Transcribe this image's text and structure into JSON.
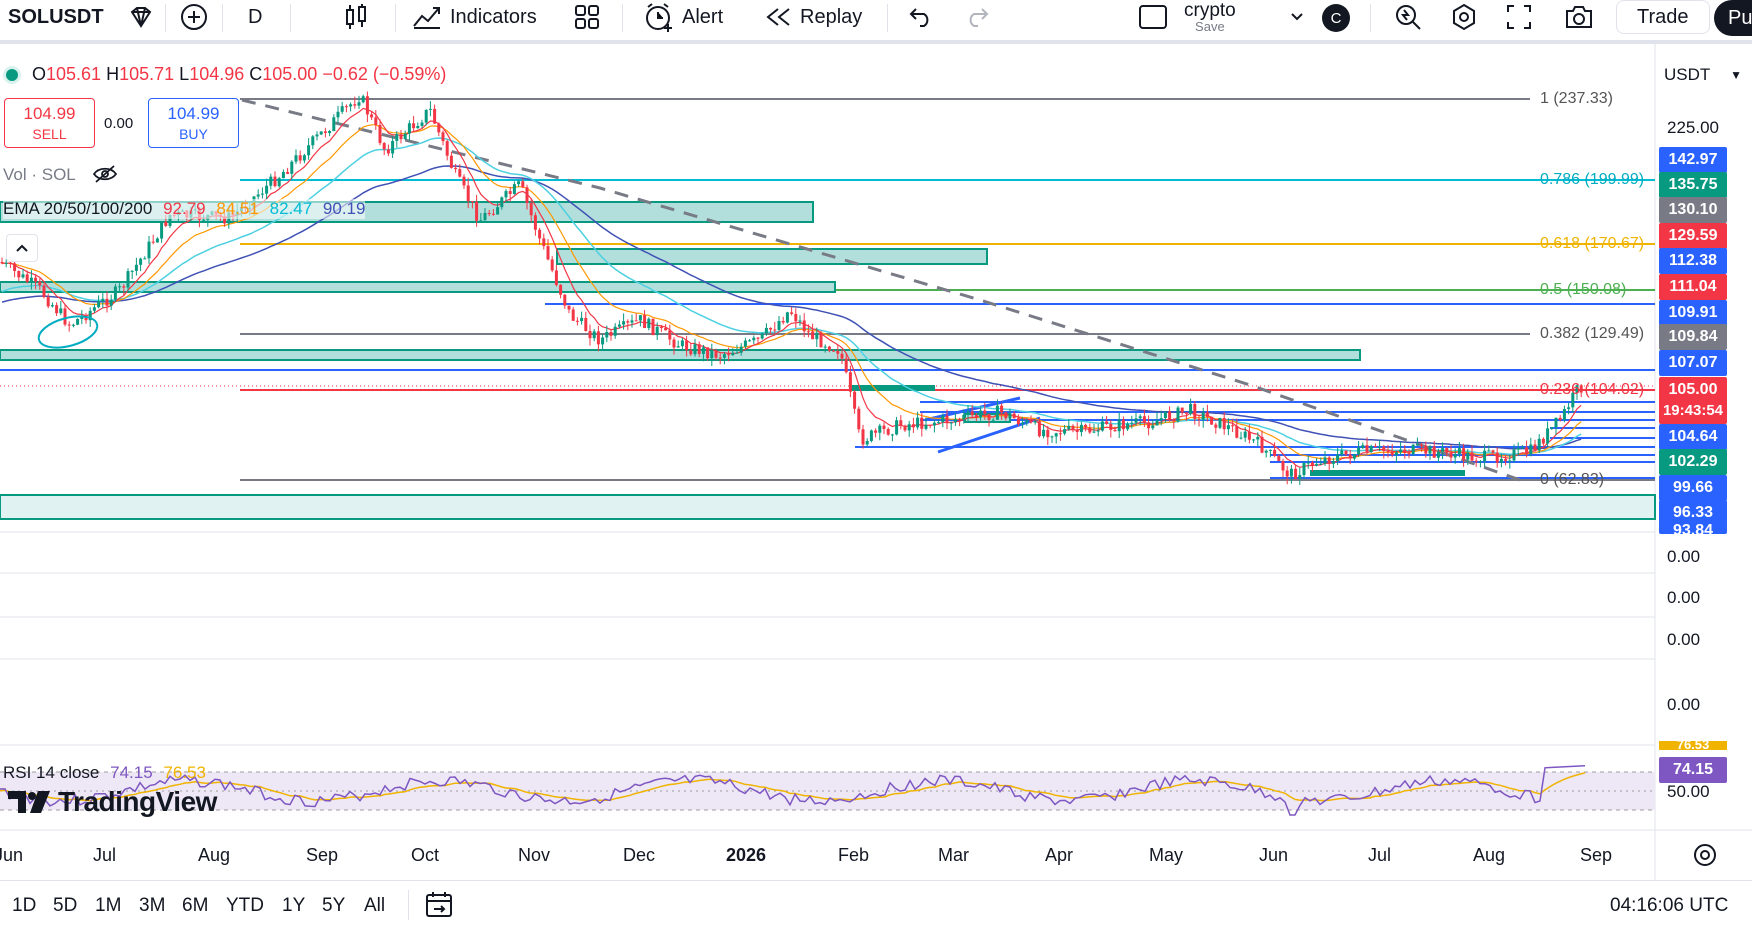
{
  "toolbar": {
    "symbol": "SOLUSDT",
    "interval": "D",
    "indicators_label": "Indicators",
    "alert_label": "Alert",
    "replay_label": "Replay",
    "layout_name": "crypto",
    "layout_save": "Save",
    "avatar_letter": "C",
    "trade_label": "Trade",
    "publish_label": "Pu"
  },
  "ohlc": {
    "open_key": "O",
    "open": "105.61",
    "high_key": "H",
    "high": "105.71",
    "low_key": "L",
    "low": "104.96",
    "close_key": "C",
    "close": "105.00",
    "change": "−0.62 (−0.59%)"
  },
  "trade": {
    "sell_price": "104.99",
    "sell_label": "SELL",
    "spread": "0.00",
    "buy_price": "104.99",
    "buy_label": "BUY"
  },
  "legends": {
    "vol": "Vol · SOL",
    "ema_name": "EMA 20/50/100/200",
    "ema20": "92.79",
    "ema50": "84.51",
    "ema100": "82.47",
    "ema200": "90.19",
    "rsi_name": "RSI 14 close",
    "rsi_value": "74.15",
    "rsi_ma": "76.53"
  },
  "currency": "USDT",
  "fib_labels": [
    {
      "text": "1 (237.33)",
      "color": "#555555"
    },
    {
      "text": "0.786 (199.99)",
      "color": "#00acc1"
    },
    {
      "text": "0.618 (170.67)",
      "color": "#f0b400"
    },
    {
      "text": "0.5 (150.08)",
      "color": "#4caf50"
    },
    {
      "text": "0.382 (129.49)",
      "color": "#555555"
    },
    {
      "text": "0.236 (104.02)",
      "color": "#f23645"
    },
    {
      "text": "0 (62.83)",
      "color": "#555555"
    }
  ],
  "price_axis": {
    "ticks": [
      "225.00",
      "0.00",
      "0.00",
      "0.00",
      "0.00",
      "50.00"
    ],
    "labels": [
      {
        "text": "142.97",
        "bg": "#2962ff"
      },
      {
        "text": "135.75",
        "bg": "#089981"
      },
      {
        "text": "130.10",
        "bg": "#787b86"
      },
      {
        "text": "129.59",
        "bg": "#f23645"
      },
      {
        "text": "112.38",
        "bg": "#2962ff"
      },
      {
        "text": "111.04",
        "bg": "#f23645"
      },
      {
        "text": "109.91",
        "bg": "#2962ff"
      },
      {
        "text": "109.84",
        "bg": "#787b86"
      },
      {
        "text": "107.07",
        "bg": "#2962ff"
      },
      {
        "text": "105.00",
        "bg": "#f23645"
      },
      {
        "text": "19:43:54",
        "bg": "#f23645"
      },
      {
        "text": "104.64",
        "bg": "#2962ff"
      },
      {
        "text": "102.29",
        "bg": "#089981"
      },
      {
        "text": "99.66",
        "bg": "#2962ff"
      },
      {
        "text": "96.33",
        "bg": "#2962ff"
      },
      {
        "text": "93.84",
        "bg": "#2962ff"
      }
    ],
    "rsi_marker": "74.15",
    "rsi_top": "76.53"
  },
  "time_axis": [
    "Jun",
    "Jul",
    "Aug",
    "Sep",
    "Oct",
    "Nov",
    "Dec",
    "2026",
    "Feb",
    "Mar",
    "Apr",
    "May",
    "Jun",
    "Jul",
    "Aug",
    "Sep"
  ],
  "ranges": [
    "1D",
    "5D",
    "1M",
    "3M",
    "6M",
    "YTD",
    "1Y",
    "5Y",
    "All"
  ],
  "clock": "04:16:06 UTC",
  "logo_text": "TradingView",
  "colors": {
    "up": "#089981",
    "down": "#f23645",
    "accent": "#2962ff",
    "zone_fill": "#b2dfdb",
    "zone_border": "#089981"
  }
}
